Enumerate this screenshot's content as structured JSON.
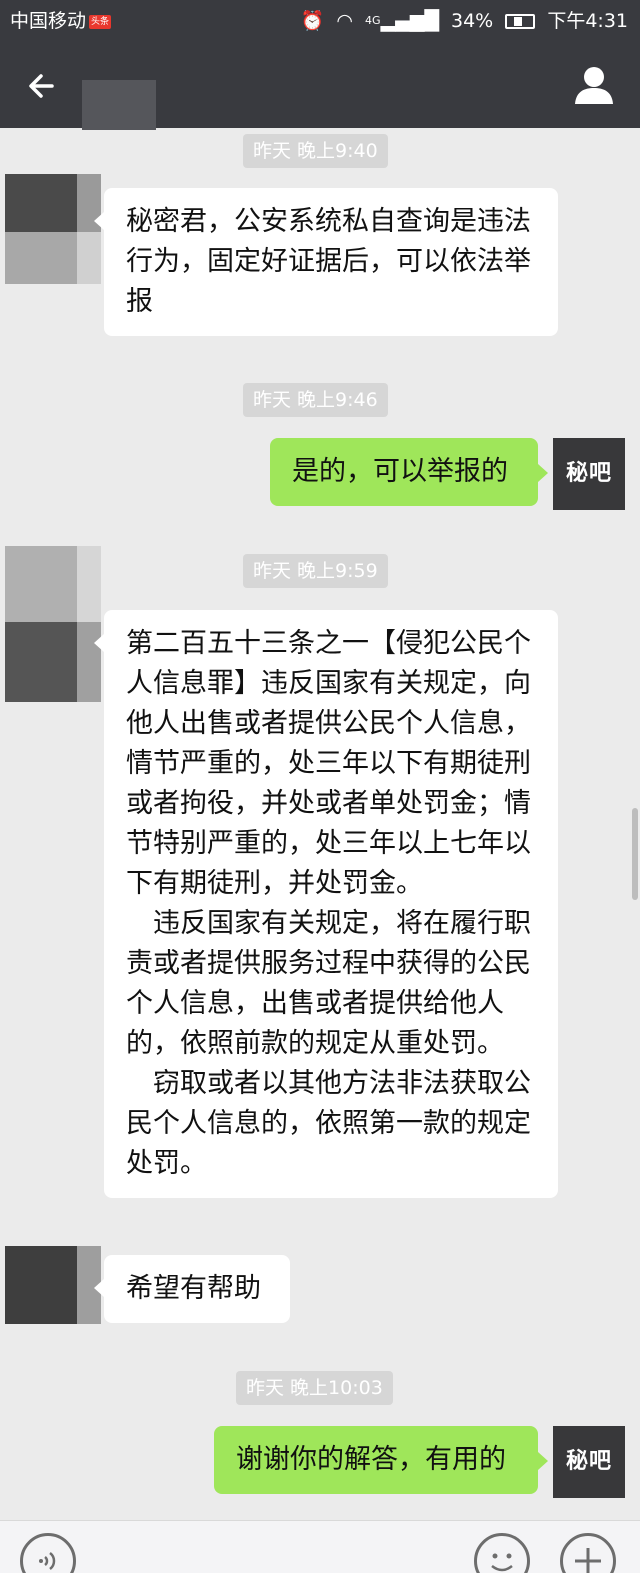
{
  "status_bar": {
    "carrier": "中国移动",
    "carrier_badge": "头条",
    "network": "4G",
    "battery_percent": "34%",
    "battery_level": 0.34,
    "time": "下午4:31"
  },
  "header": {
    "back_icon": "back-arrow-icon",
    "profile_icon": "person-icon"
  },
  "messages": [
    {
      "type": "timestamp",
      "text": "昨天 晚上9:40"
    },
    {
      "type": "incoming",
      "text": "秘密君，公安系统私自查询是违法行为，固定好证据后，可以依法举报"
    },
    {
      "type": "timestamp",
      "text": "昨天 晚上9:46"
    },
    {
      "type": "outgoing",
      "text": "是的，可以举报的"
    },
    {
      "type": "timestamp",
      "text": "昨天 晚上9:59"
    },
    {
      "type": "incoming",
      "paragraphs": [
        "第二百五十三条之一【侵犯公民个人信息罪】违反国家有关规定，向他人出售或者提供公民个人信息，情节严重的，处三年以下有期徒刑或者拘役，并处或者单处罚金；情节特别严重的，处三年以上七年以下有期徒刑，并处罚金。",
        "违反国家有关规定，将在履行职责或者提供服务过程中获得的公民个人信息，出售或者提供给他人的，依照前款的规定从重处罚。",
        "窃取或者以其他方法非法获取公民个人信息的，依照第一款的规定处罚。"
      ]
    },
    {
      "type": "incoming",
      "text": "希望有帮助"
    },
    {
      "type": "timestamp",
      "text": "昨天 晚上10:03"
    },
    {
      "type": "outgoing",
      "text": "谢谢你的解答，有用的"
    }
  ],
  "my_avatar_text": "秘吧",
  "input_bar": {
    "voice_icon": "voice-icon",
    "emoji_icon": "emoji-icon",
    "plus_icon": "plus-icon"
  },
  "colors": {
    "bar_bg": "#393a3f",
    "chat_bg": "#ebebeb",
    "incoming_bubble": "#ffffff",
    "outgoing_bubble": "#9fe65a",
    "timestamp_bg": "#d6d6d6"
  }
}
